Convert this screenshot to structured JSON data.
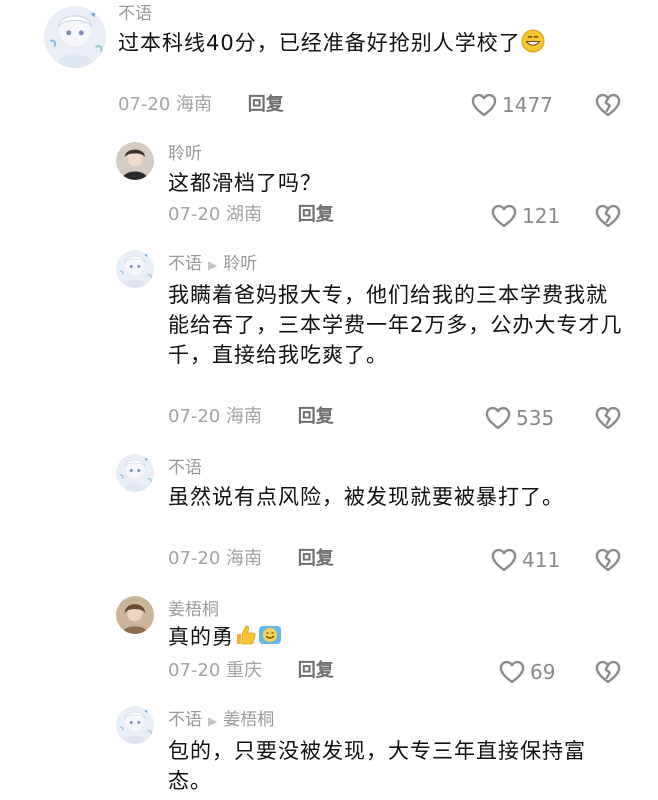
{
  "comments": [
    {
      "name": "不语",
      "reply_to": "",
      "text": "过本科线40分，已经准备好抢别人学校了",
      "date": "07-20",
      "region": "海南",
      "reply_label": "回复",
      "likes": "1477"
    },
    {
      "name": "聆听",
      "reply_to": "",
      "text": "这都滑档了吗？",
      "date": "07-20",
      "region": "湖南",
      "reply_label": "回复",
      "likes": "121"
    },
    {
      "name": "不语",
      "reply_to": "聆听",
      "text": "我瞒着爸妈报大专，他们给我的三本学费我就能给吞了，三本学费一年2万多，公办大专才几千，直接给我吃爽了。",
      "date": "07-20",
      "region": "海南",
      "reply_label": "回复",
      "likes": "535"
    },
    {
      "name": "不语",
      "reply_to": "",
      "text": "虽然说有点风险，被发现就要被暴打了。",
      "date": "07-20",
      "region": "海南",
      "reply_label": "回复",
      "likes": "411"
    },
    {
      "name": "姜梧桐",
      "reply_to": "",
      "text": "真的勇",
      "date": "07-20",
      "region": "重庆",
      "reply_label": "回复",
      "likes": "69"
    },
    {
      "name": "不语",
      "reply_to": "姜梧桐",
      "text": "包的，只要没被发现，大专三年直接保持富态。",
      "date": "",
      "region": "",
      "reply_label": "",
      "likes": ""
    }
  ],
  "icons": {
    "like": "heart-outline-icon",
    "dislike": "broken-heart-icon",
    "reply_arrow": "play-arrow-icon"
  },
  "colors": {
    "name": "#9a9a9a",
    "text": "#111111",
    "meta": "#a3a3a3",
    "icon": "#8a8a8a"
  }
}
